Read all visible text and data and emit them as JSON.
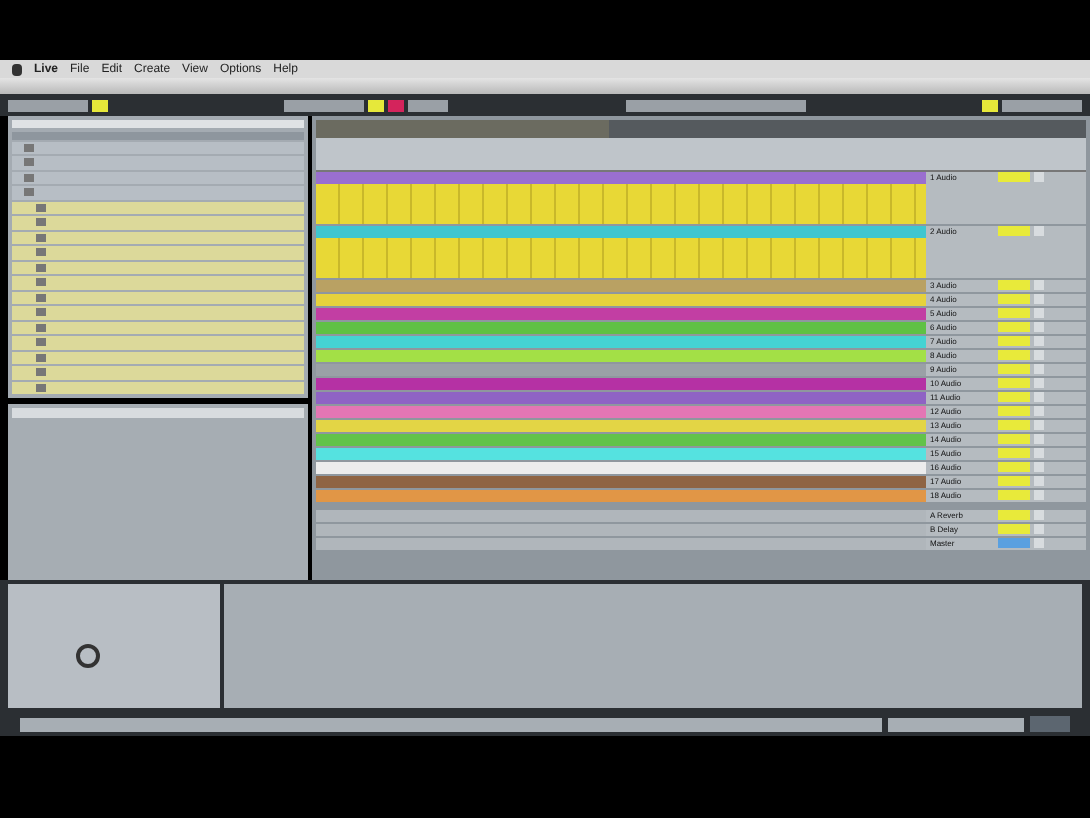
{
  "menu_bar": {
    "items": [
      "Live",
      "File",
      "Edit",
      "Create",
      "View",
      "Options",
      "Help"
    ]
  },
  "browser": {
    "rows": [
      {
        "kind": "folder"
      },
      {
        "kind": "folder"
      },
      {
        "kind": "folder"
      },
      {
        "kind": "folder"
      },
      {
        "kind": "file"
      },
      {
        "kind": "file"
      },
      {
        "kind": "file"
      },
      {
        "kind": "file"
      },
      {
        "kind": "file"
      },
      {
        "kind": "file"
      },
      {
        "kind": "file"
      },
      {
        "kind": "file"
      },
      {
        "kind": "file"
      },
      {
        "kind": "file"
      },
      {
        "kind": "file"
      },
      {
        "kind": "file"
      },
      {
        "kind": "file"
      }
    ]
  },
  "tracks": [
    {
      "name": "1 Audio",
      "color": "#9a6fcf",
      "expanded": true
    },
    {
      "name": "2 Audio",
      "color": "#3fc6cf",
      "expanded": true
    },
    {
      "name": "3 Audio",
      "color": "#b9a163",
      "expanded": false
    },
    {
      "name": "4 Audio",
      "color": "#e6d23c",
      "expanded": false
    },
    {
      "name": "5 Audio",
      "color": "#c23ea3",
      "expanded": false
    },
    {
      "name": "6 Audio",
      "color": "#5fc144",
      "expanded": false
    },
    {
      "name": "7 Audio",
      "color": "#45d3d3",
      "expanded": false
    },
    {
      "name": "8 Audio",
      "color": "#a3e046",
      "expanded": false
    },
    {
      "name": "9 Audio",
      "color": "#9aa0a6",
      "expanded": false
    },
    {
      "name": "10 Audio",
      "color": "#b531a4",
      "expanded": false
    },
    {
      "name": "11 Audio",
      "color": "#8f63c4",
      "expanded": false
    },
    {
      "name": "12 Audio",
      "color": "#e476b4",
      "expanded": false
    },
    {
      "name": "13 Audio",
      "color": "#e3d545",
      "expanded": false
    },
    {
      "name": "14 Audio",
      "color": "#62c34a",
      "expanded": false
    },
    {
      "name": "15 Audio",
      "color": "#55e2e0",
      "expanded": false
    },
    {
      "name": "16 Audio",
      "color": "#ececec",
      "expanded": false
    },
    {
      "name": "17 Audio",
      "color": "#8f6443",
      "expanded": false
    },
    {
      "name": "18 Audio",
      "color": "#e19646",
      "expanded": false
    }
  ],
  "returns": [
    {
      "name": "A Reverb"
    },
    {
      "name": "B Delay"
    },
    {
      "name": "Master"
    }
  ]
}
